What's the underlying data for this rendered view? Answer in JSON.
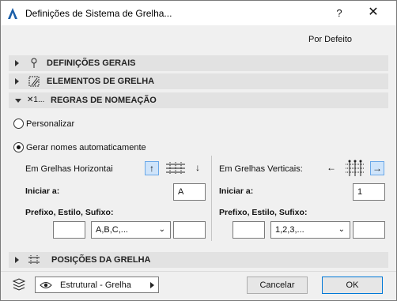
{
  "window": {
    "title": "Definições de Sistema de Grelha...",
    "help": "?",
    "close": "✕"
  },
  "default_label": "Por Defeito",
  "sections": {
    "general": "DEFINIÇÕES GERAIS",
    "elements": "ELEMENTOS DE GRELHA",
    "naming": "REGRAS DE NOMEAÇÃO",
    "naming_icon_text": "✕1...",
    "positions": "POSIÇÕES DA GRELHA"
  },
  "naming": {
    "option_custom": "Personalizar",
    "option_auto": "Gerar nomes automaticamente",
    "selected": "auto",
    "horizontal": {
      "heading": "Em Grelhas Horizontai",
      "start_label": "Iniciar a:",
      "start_value": "A",
      "prefix_label": "Prefixo, Estilo, Sufixo:",
      "prefix_value": "",
      "style_value": "A,B,C,...",
      "suffix_value": ""
    },
    "vertical": {
      "heading": "Em Grelhas Verticais:",
      "start_label": "Iniciar a:",
      "start_value": "1",
      "prefix_label": "Prefixo, Estilo, Sufixo:",
      "prefix_value": "",
      "style_value": "1,2,3,...",
      "suffix_value": ""
    }
  },
  "footer": {
    "view_value": "Estrutural - Grelha",
    "cancel": "Cancelar",
    "ok": "OK"
  },
  "colors": {
    "accent": "#0078d7",
    "active_tool_bg": "#cfe4fa",
    "section_bg": "#e2e2e2"
  }
}
